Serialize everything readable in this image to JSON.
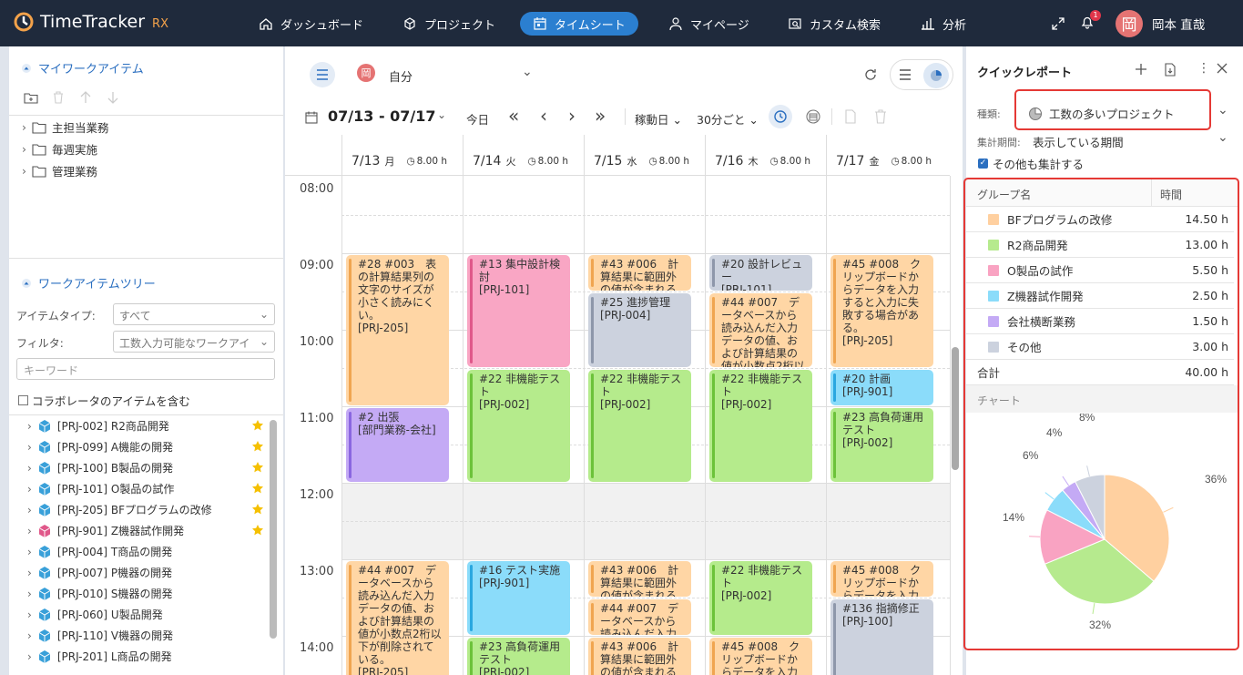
{
  "app": {
    "name": "TimeTracker",
    "suffix": "RX"
  },
  "nav": [
    {
      "label": "ダッシュボード",
      "icon": "home-icon"
    },
    {
      "label": "プロジェクト",
      "icon": "cube-icon"
    },
    {
      "label": "タイムシート",
      "icon": "calendar-icon",
      "active": true
    },
    {
      "label": "マイページ",
      "icon": "person-icon"
    },
    {
      "label": "カスタム検索",
      "icon": "search-list-icon"
    },
    {
      "label": "分析",
      "icon": "bar-chart-icon"
    }
  ],
  "notifications": {
    "count": "1"
  },
  "user": {
    "avatar_char": "岡",
    "name": "岡本 直哉"
  },
  "left": {
    "my_work_items": {
      "title": "マイワークアイテム",
      "folders": [
        "主担当業務",
        "毎週実施",
        "管理業務"
      ]
    },
    "tree": {
      "title": "ワークアイテムツリー",
      "item_type_label": "アイテムタイプ:",
      "item_type_value": "すべて",
      "filter_label": "フィルタ:",
      "filter_value": "工数入力可能なワークアイ",
      "keyword_placeholder": "キーワード",
      "collaborator_label": "コラボレータのアイテムを含む",
      "items": [
        {
          "label": "[PRJ-002] R2商品開発",
          "star": true,
          "color": "#39a0d9"
        },
        {
          "label": "[PRJ-099] A機能の開発",
          "star": true,
          "color": "#39a0d9"
        },
        {
          "label": "[PRJ-100] B製品の開発",
          "star": true,
          "color": "#39a0d9"
        },
        {
          "label": "[PRJ-101] O製品の試作",
          "star": true,
          "color": "#39a0d9"
        },
        {
          "label": "[PRJ-205] BFプログラムの改修",
          "star": true,
          "color": "#39a0d9"
        },
        {
          "label": "[PRJ-901] Z機器試作開発",
          "star": true,
          "color": "#e0588a"
        },
        {
          "label": "[PRJ-004] T商品の開発",
          "star": false,
          "color": "#39a0d9"
        },
        {
          "label": "[PRJ-007] P機器の開発",
          "star": false,
          "color": "#39a0d9"
        },
        {
          "label": "[PRJ-010] S機器の開発",
          "star": false,
          "color": "#39a0d9"
        },
        {
          "label": "[PRJ-060] U製品開発",
          "star": false,
          "color": "#39a0d9"
        },
        {
          "label": "[PRJ-110] V機器の開発",
          "star": false,
          "color": "#39a0d9"
        },
        {
          "label": "[PRJ-201] L商品の開発",
          "star": false,
          "color": "#39a0d9"
        }
      ]
    }
  },
  "calendar": {
    "user_avatar_char": "岡",
    "user_label": "自分",
    "range": "07/13 - 07/17",
    "today": "今日",
    "workday_filter": "稼動日",
    "interval": "30分ごと",
    "days": [
      {
        "date": "7/13",
        "dow": "月",
        "hours": "8.00 h"
      },
      {
        "date": "7/14",
        "dow": "火",
        "hours": "8.00 h"
      },
      {
        "date": "7/15",
        "dow": "水",
        "hours": "8.00 h"
      },
      {
        "date": "7/16",
        "dow": "木",
        "hours": "8.00 h"
      },
      {
        "date": "7/17",
        "dow": "金",
        "hours": "8.00 h"
      }
    ],
    "times": [
      "08:00",
      "09:00",
      "10:00",
      "11:00",
      "12:00",
      "13:00",
      "14:00"
    ],
    "events": [
      {
        "text": "#28 #003　表の計算結果列の文字のサイズが小さく読みにくい。\n[PRJ-205]"
      },
      {
        "text": "#2 出張\n[部門業務-会社]"
      },
      {
        "text": "#44 #007　データベースから読み込んだ入力データの値、および計算結果の値が小数点2桁以下が削除されている。\n[PRJ-205]"
      },
      {
        "text": "#13 集中設計検討\n[PRJ-101]"
      },
      {
        "text": "#22 非機能テスト\n[PRJ-002]"
      },
      {
        "text": "#16 テスト実施\n[PRJ-901]"
      },
      {
        "text": "#23 高負荷運用テスト\n[PRJ-002]"
      },
      {
        "text": "#43 #006　計算結果に範囲外の値が含まれる"
      },
      {
        "text": "#25 進捗管理\n[PRJ-004]"
      },
      {
        "text": "#22 非機能テスト\n[PRJ-002]"
      },
      {
        "text": "#43 #006　計算結果に範囲外の値が含まれる"
      },
      {
        "text": "#44 #007　データベースから読み込んだ入力"
      },
      {
        "text": "#43 #006　計算結果に範囲外の値が含まれる"
      },
      {
        "text": "#20 設計レビュー\n[PRJ-101]"
      },
      {
        "text": "#44 #007　データベースから読み込んだ入力データの値、および計算結果の値が小数点2桁以"
      },
      {
        "text": "#22 非機能テスト\n[PRJ-002]"
      },
      {
        "text": "#22 非機能テスト\n[PRJ-002]"
      },
      {
        "text": "#45 #008　クリップボードからデータを入力"
      },
      {
        "text": "#45 #008　クリップボードからデータを入力すると入力に失敗する場合がある。\n[PRJ-205]"
      },
      {
        "text": "#20 計画\n[PRJ-901]"
      },
      {
        "text": "#23 高負荷運用テスト\n[PRJ-002]"
      },
      {
        "text": "#45 #008　クリップボードからデータを入力"
      },
      {
        "text": "#136 指摘修正\n[PRJ-100]"
      }
    ]
  },
  "quick_report": {
    "title": "クイックレポート",
    "type_label": "種類:",
    "type_value": "工数の多いプロジェクト",
    "period_label": "集計期間:",
    "period_value": "表示している期間",
    "include_others": "その他も集計する",
    "col_group": "グループ名",
    "col_time": "時間",
    "rows": [
      {
        "name": "BFプログラムの改修",
        "time": "14.50 h",
        "color": "#ffd0a0"
      },
      {
        "name": "R2商品開発",
        "time": "13.00 h",
        "color": "#b6ea8e"
      },
      {
        "name": "O製品の試作",
        "time": "5.50 h",
        "color": "#f9a3c2"
      },
      {
        "name": "Z機器試作開発",
        "time": "2.50 h",
        "color": "#8bdcfa"
      },
      {
        "name": "会社横断業務",
        "time": "1.50 h",
        "color": "#c4aaf5"
      },
      {
        "name": "その他",
        "time": "3.00 h",
        "color": "#ccd2de"
      }
    ],
    "total_label": "合計",
    "total_value": "40.00 h",
    "chart_label": "チャート"
  },
  "chart_data": {
    "type": "pie",
    "categories": [
      "BFプログラムの改修",
      "R2商品開発",
      "O製品の試作",
      "Z機器試作開発",
      "会社横断業務",
      "その他"
    ],
    "values": [
      14.5,
      13.0,
      5.5,
      2.5,
      1.5,
      3.0
    ],
    "labels": [
      "36%",
      "32%",
      "14%",
      "6%",
      "4%",
      "8%"
    ],
    "colors": [
      "#ffd0a0",
      "#b6ea8e",
      "#f9a3c2",
      "#8bdcfa",
      "#c4aaf5",
      "#ccd2de"
    ]
  }
}
